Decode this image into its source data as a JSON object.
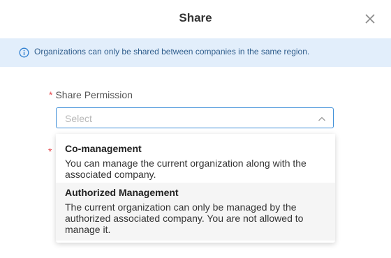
{
  "dialog": {
    "title": "Share",
    "notice": "Organizations can only be shared between companies in the same region."
  },
  "form": {
    "permission_label": "Share Permission",
    "required_mark": "*",
    "select_placeholder": "Select",
    "options": [
      {
        "title": "Co-management",
        "description": "You can manage the current organization along with the associated company."
      },
      {
        "title": "Authorized Management",
        "description": "The current organization can only be managed by the authorized associated company. You are not allowed to manage it."
      }
    ]
  },
  "icons": {
    "close": "close-icon",
    "info": "info-icon",
    "chevron": "chevron-up-icon"
  },
  "colors": {
    "accent": "#3f8fd8",
    "notice_bg": "#e2eefb",
    "required": "#e5484d",
    "hover_bg": "#f5f5f5"
  }
}
